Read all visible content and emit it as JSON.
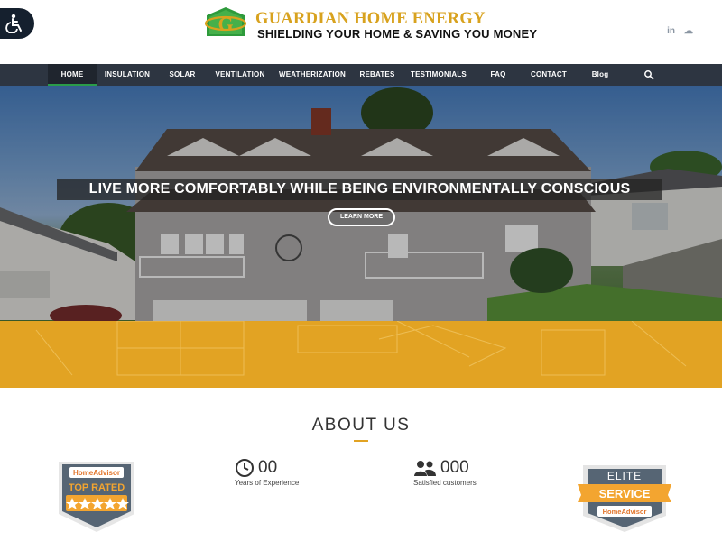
{
  "header": {
    "brand_name": "GUARDIAN HOME ENERGY",
    "tagline": "SHIELDING YOUR HOME & SAVING YOU MONEY",
    "logo_letter": "G",
    "social": {
      "linkedin": "in",
      "soundcloud": "☁"
    }
  },
  "nav": {
    "items": [
      {
        "label": "HOME",
        "active": true
      },
      {
        "label": "INSULATION"
      },
      {
        "label": "SOLAR"
      },
      {
        "label": "VENTILATION"
      },
      {
        "label": "WEATHERIZATION"
      },
      {
        "label": "REBATES"
      },
      {
        "label": "TESTIMONIALS"
      },
      {
        "label": "FAQ"
      },
      {
        "label": "CONTACT"
      },
      {
        "label": "Blog"
      }
    ]
  },
  "hero": {
    "headline": "LIVE MORE COMFORTABLY WHILE BEING ENVIRONMENTALLY CONSCIOUS",
    "cta_label": "LEARN MORE"
  },
  "about": {
    "title": "ABOUT US",
    "stats": [
      {
        "icon": "clock-icon",
        "value": "00",
        "label": "Years of Experience"
      },
      {
        "icon": "users-icon",
        "value": "000",
        "label": "Satisfied customers"
      }
    ],
    "badge_left": {
      "brand": "HomeAdvisor",
      "label": "TOP RATED"
    },
    "badge_right": {
      "top": "ELITE",
      "label": "SERVICE",
      "brand": "HomeAdvisor"
    }
  },
  "colors": {
    "nav_bg": "#2d3541",
    "accent_gold": "#e2a323",
    "active_underline": "#2a9c4a",
    "logo_gold": "#d8a21e"
  }
}
